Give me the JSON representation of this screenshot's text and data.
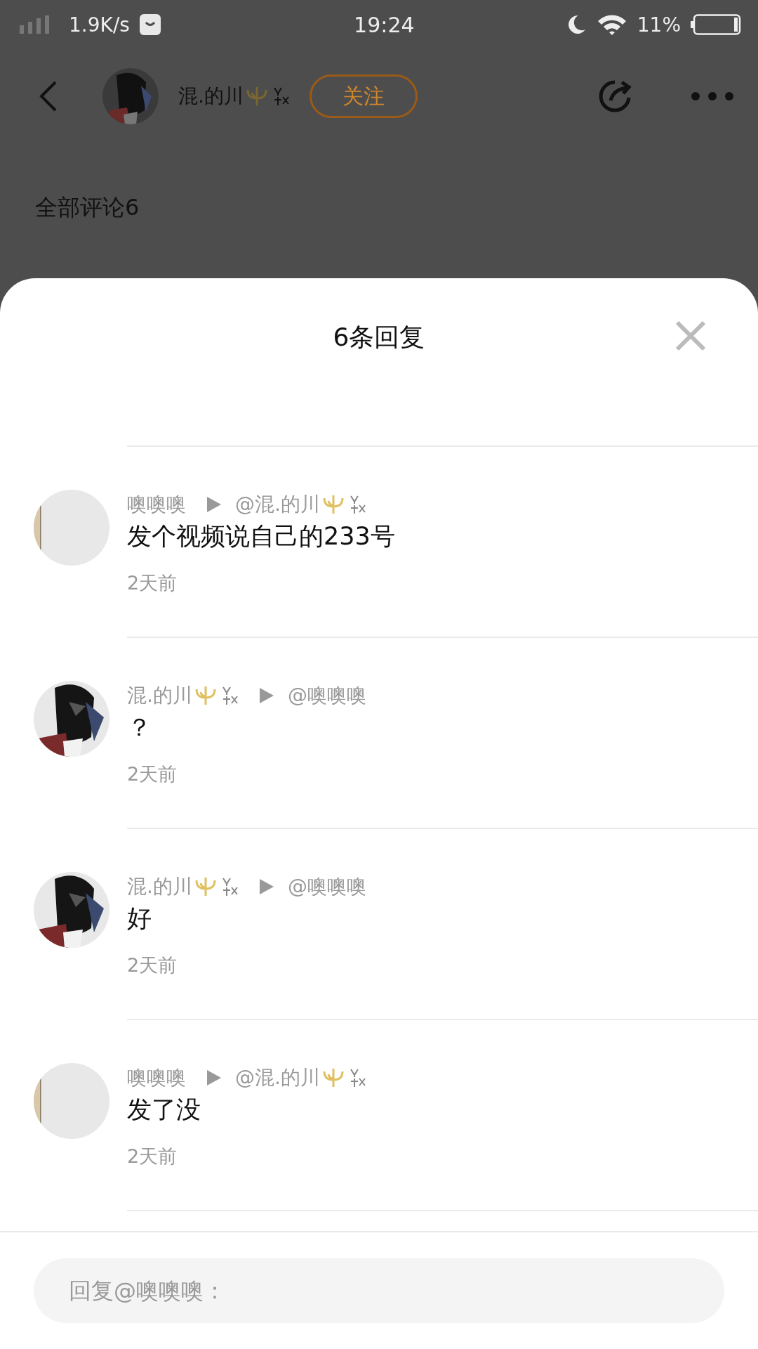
{
  "status_bar": {
    "network_speed": "1.9K/s",
    "time": "19:24",
    "battery": "11%"
  },
  "header": {
    "username": "混.的川",
    "follow_button": "关注"
  },
  "comments_heading": "全部评论6",
  "sheet": {
    "title": "6条回复",
    "replies": [
      {
        "kind": "placeholder",
        "author": "噢噢噢",
        "author_badges": false,
        "target": "@混.的川",
        "target_badges": true,
        "text": "发个视频说自己的233号",
        "time": "2天前"
      },
      {
        "kind": "picture",
        "author": "混.的川",
        "author_badges": true,
        "target": "@噢噢噢",
        "target_badges": false,
        "text": "？",
        "time": "2天前"
      },
      {
        "kind": "picture",
        "author": "混.的川",
        "author_badges": true,
        "target": "@噢噢噢",
        "target_badges": false,
        "text": "好",
        "time": "2天前"
      },
      {
        "kind": "placeholder",
        "author": "噢噢噢",
        "author_badges": false,
        "target": "@混.的川",
        "target_badges": true,
        "text": "发了没",
        "time": "2天前"
      }
    ]
  },
  "reply_field": {
    "placeholder": "回复@噢噢噢："
  }
}
